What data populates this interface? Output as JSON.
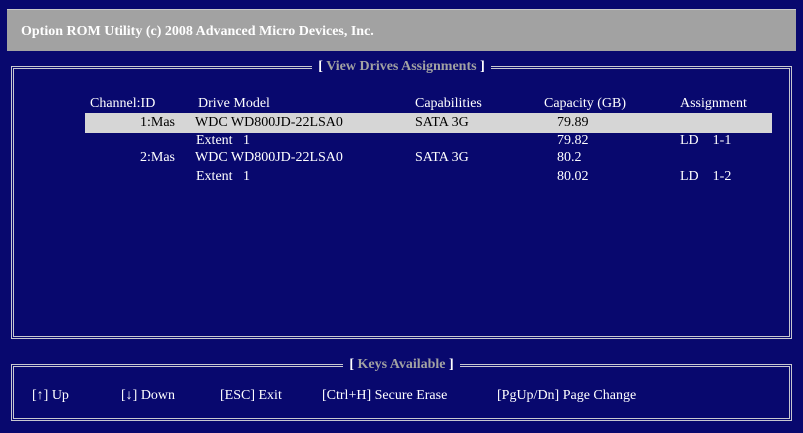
{
  "title": "Option ROM Utility (c) 2008 Advanced Micro Devices, Inc.",
  "main_panel": {
    "title": "View Drives Assignments",
    "headers": {
      "channel": "Channel:ID",
      "model": "Drive Model",
      "capabilities": "Capabilities",
      "capacity": "Capacity (GB)",
      "assignment": "Assignment"
    },
    "rows": [
      {
        "channel": "1:Mas",
        "model": "WDC WD800JD-22LSA0",
        "capabilities": "SATA 3G",
        "capacity": "79.89",
        "assignment": "",
        "selected": true
      },
      {
        "channel": "",
        "model": "Extent   1",
        "capabilities": "",
        "capacity": "79.82",
        "assignment": "LD    1-1",
        "selected": false
      },
      {
        "channel": "2:Mas",
        "model": "WDC WD800JD-22LSA0",
        "capabilities": "SATA 3G",
        "capacity": "80.2",
        "assignment": "",
        "selected": false
      },
      {
        "channel": "",
        "model": "Extent   1",
        "capabilities": "",
        "capacity": "80.02",
        "assignment": "LD    1-2",
        "selected": false
      }
    ]
  },
  "keys_panel": {
    "title": "Keys Available",
    "keys": [
      "[↑] Up",
      "[↓] Down",
      "[ESC] Exit",
      "[Ctrl+H] Secure Erase",
      "[PgUp/Dn] Page Change"
    ]
  },
  "colors": {
    "background": "#08086e",
    "title_bar": "#a2a2a2",
    "selection": "#d6d6d6",
    "panel_title_highlight": "#a2a2a2"
  }
}
